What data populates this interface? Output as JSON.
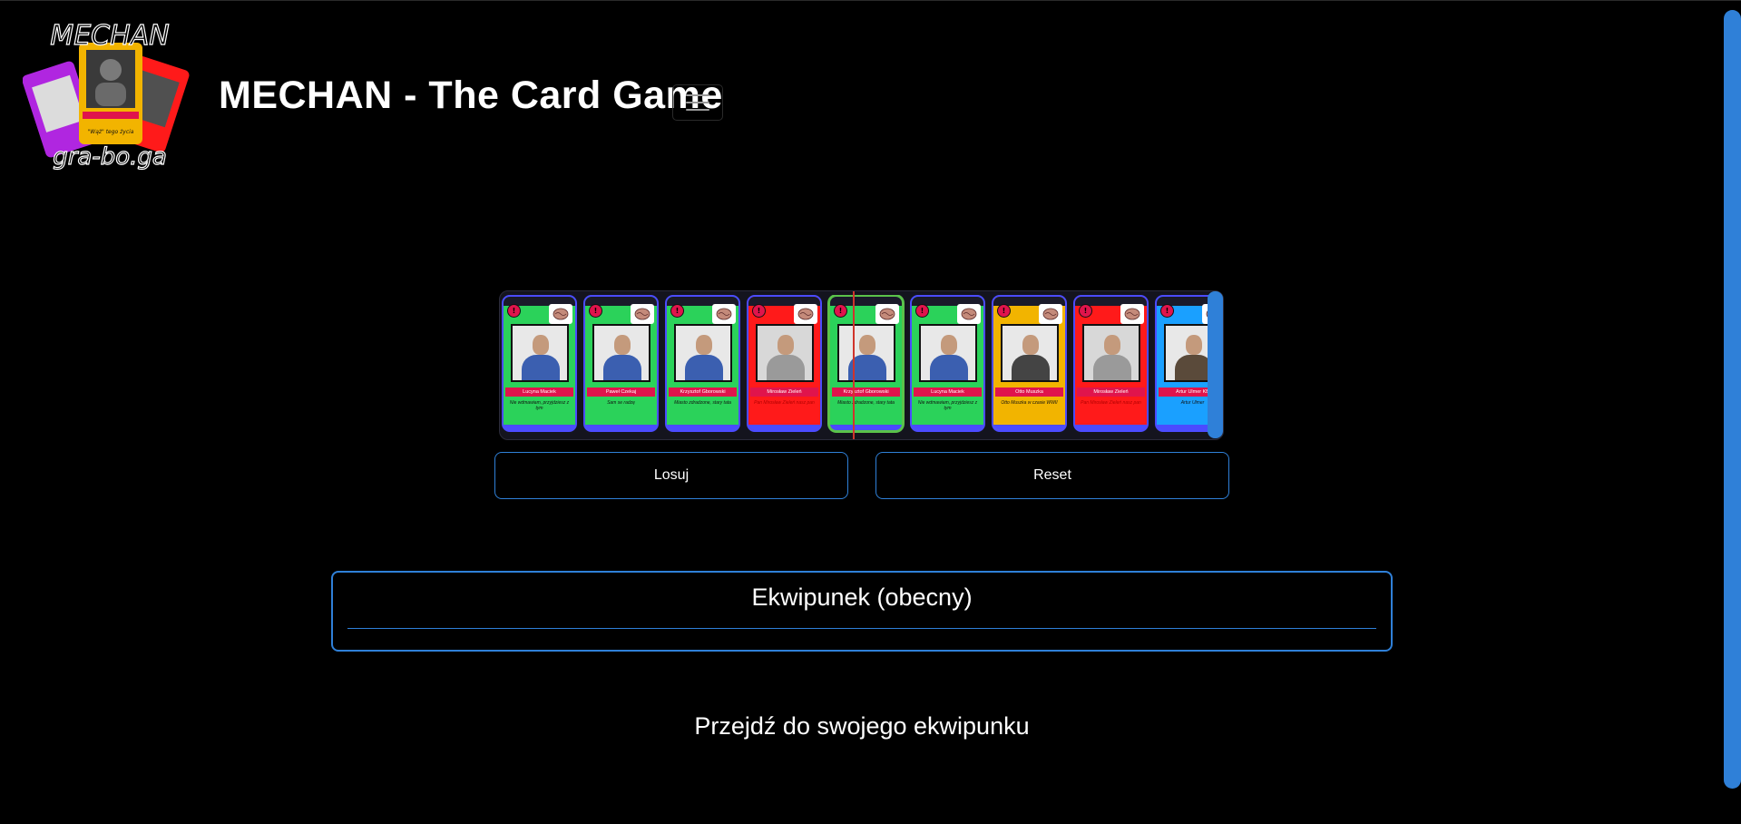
{
  "header": {
    "title": "MECHAN - The Card Game",
    "logo_text_top": "MECHAN",
    "logo_text_bottom": "gra-bo.ga",
    "menu_icon": "hamburger-icon"
  },
  "roller": {
    "cards": [
      {
        "color": "green",
        "name": "Lucyna Maciek",
        "quote": "Nie wdmawiam, przyjdziesz z tym"
      },
      {
        "color": "green",
        "name": "Paweł Czekaj",
        "quote": "Sam se radzę"
      },
      {
        "color": "green",
        "name": "Krzysztof Gborowski",
        "quote": "Miasto zdradzone, stary tata"
      },
      {
        "color": "red",
        "name": "Mirosław Zieleń",
        "quote": "Pan Mirosław Zieleń nasz pan"
      },
      {
        "color": "green",
        "name": "Krzysztof Gborowski",
        "quote": "Miasto zdradzone, stary tata",
        "highlight": true
      },
      {
        "color": "green",
        "name": "Lucyna Maciek",
        "quote": "Nie wdmawiam, przyjdziesz z tym"
      },
      {
        "color": "yellow",
        "name": "Otto Muszka",
        "quote": "Otto Muszka w czasie WWII"
      },
      {
        "color": "red",
        "name": "Mirosław Zieleń",
        "quote": "Pan Mirosław Zieleń nasz pan"
      },
      {
        "color": "blue",
        "name": "Artur Ulmer KB",
        "quote": "Artur Ulmer"
      }
    ],
    "badge_symbol": "!"
  },
  "buttons": {
    "draw_label": "Losuj",
    "reset_label": "Reset"
  },
  "inventory": {
    "title": "Ekwipunek (obecny)"
  },
  "link": {
    "goto_inventory": "Przejdź do swojego ekwipunku"
  },
  "colors": {
    "accent": "#2f80d8",
    "card_green": "#2bd25a",
    "card_red": "#ff1a1a",
    "card_yellow": "#f2b400",
    "card_blue": "#1aa0ff",
    "name_bar": "#e0144c",
    "pointer_line": "#d0342c"
  }
}
